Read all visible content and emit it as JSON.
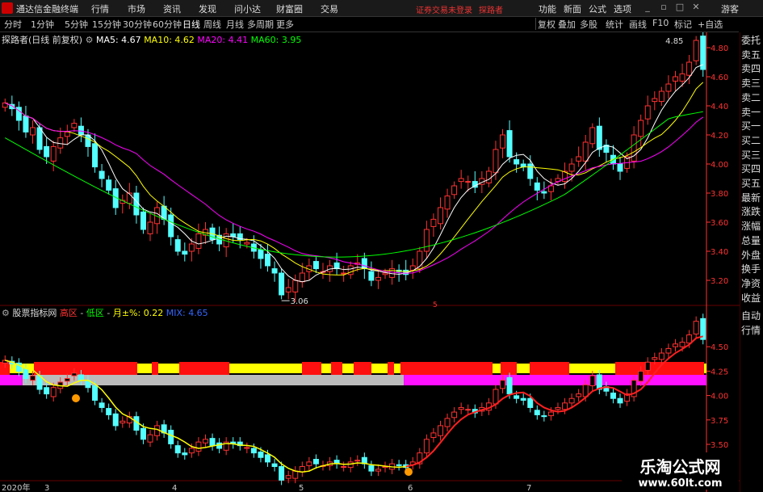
{
  "app": {
    "title": "通达信金融终端"
  },
  "menu": [
    "行情",
    "市场",
    "资讯",
    "发现",
    "问小达",
    "财富圈",
    "交易"
  ],
  "notice": "证券交易未登录",
  "user": "探路者",
  "right_menu": [
    "功能",
    "新面",
    "公式",
    "选项"
  ],
  "guest": "游客",
  "periods": [
    "分时",
    "1分钟",
    "5分钟",
    "15分钟",
    "30分钟",
    "60分钟",
    "日线",
    "周线",
    "月线",
    "多周期",
    "更多"
  ],
  "active_period": "日线",
  "tools": [
    "复权",
    "叠加",
    "多股",
    "统计",
    "画线",
    "F10",
    "标记",
    "+自选"
  ],
  "main_legend": {
    "title": "探路者(日线 前复权)",
    "ma5": "MA5: 4.67",
    "ma10": "MA10: 4.62",
    "ma20": "MA20: 4.41",
    "ma60": "MA60: 3.95"
  },
  "sub_legend": {
    "title": "股票指标网",
    "item1": "高区",
    "item2": "低区",
    "item3": "月±%: 0.22",
    "item4": "MIX: 4.65"
  },
  "annotations": {
    "high": "4.85",
    "low": "3.06"
  },
  "right_panel": [
    "委托",
    "卖五",
    "卖四",
    "卖三",
    "卖二",
    "卖一",
    "买一",
    "买二",
    "买三",
    "买四",
    "买五",
    "最新",
    "涨跌",
    "涨幅",
    "总量",
    "外盘",
    "换手",
    "净资",
    "收益",
    "自动",
    "行情"
  ],
  "watermark": {
    "title": "乐淘公式网",
    "url": "www.60lt.com"
  },
  "colors": {
    "up": "#ff3232",
    "down": "#54ffff",
    "ma5": "#ffffff",
    "ma10": "#ffff00",
    "ma20": "#ff00ff",
    "ma60": "#00ff00",
    "axis": "#ff3232"
  },
  "chart_data": {
    "type": "candlestick",
    "axis_main": [
      "4.80",
      "4.60",
      "4.40",
      "4.20",
      "4.00",
      "3.80",
      "3.60",
      "3.40",
      "3.20"
    ],
    "axis_sub": [
      "4.50",
      "4.25",
      "4.00",
      "3.75",
      "3.50"
    ],
    "x_labels": [
      "2020年",
      "3",
      "4",
      "5",
      "6",
      "7"
    ],
    "close": [
      4.42,
      4.38,
      4.3,
      4.22,
      4.25,
      4.1,
      4.05,
      4.12,
      4.18,
      4.22,
      4.28,
      4.2,
      4.12,
      3.98,
      3.9,
      3.82,
      3.7,
      3.75,
      3.8,
      3.65,
      3.55,
      3.6,
      3.7,
      3.62,
      3.5,
      3.4,
      3.38,
      3.45,
      3.52,
      3.55,
      3.48,
      3.45,
      3.52,
      3.5,
      3.48,
      3.46,
      3.4,
      3.35,
      3.3,
      3.25,
      3.1,
      3.15,
      3.2,
      3.25,
      3.3,
      3.28,
      3.26,
      3.3,
      3.28,
      3.25,
      3.3,
      3.32,
      3.28,
      3.2,
      3.22,
      3.25,
      3.28,
      3.26,
      3.24,
      3.3,
      3.4,
      3.55,
      3.62,
      3.7,
      3.78,
      3.85,
      3.9,
      3.88,
      3.84,
      3.9,
      3.95,
      4.1,
      4.2,
      4.05,
      4.0,
      3.98,
      3.9,
      3.82,
      3.8,
      3.85,
      3.9,
      3.95,
      4.0,
      4.05,
      4.15,
      4.25,
      4.1,
      4.08,
      4.0,
      3.95,
      4.05,
      4.2,
      4.3,
      4.4,
      4.45,
      4.5,
      4.55,
      4.6,
      4.62,
      4.7,
      4.85,
      4.65
    ]
  }
}
